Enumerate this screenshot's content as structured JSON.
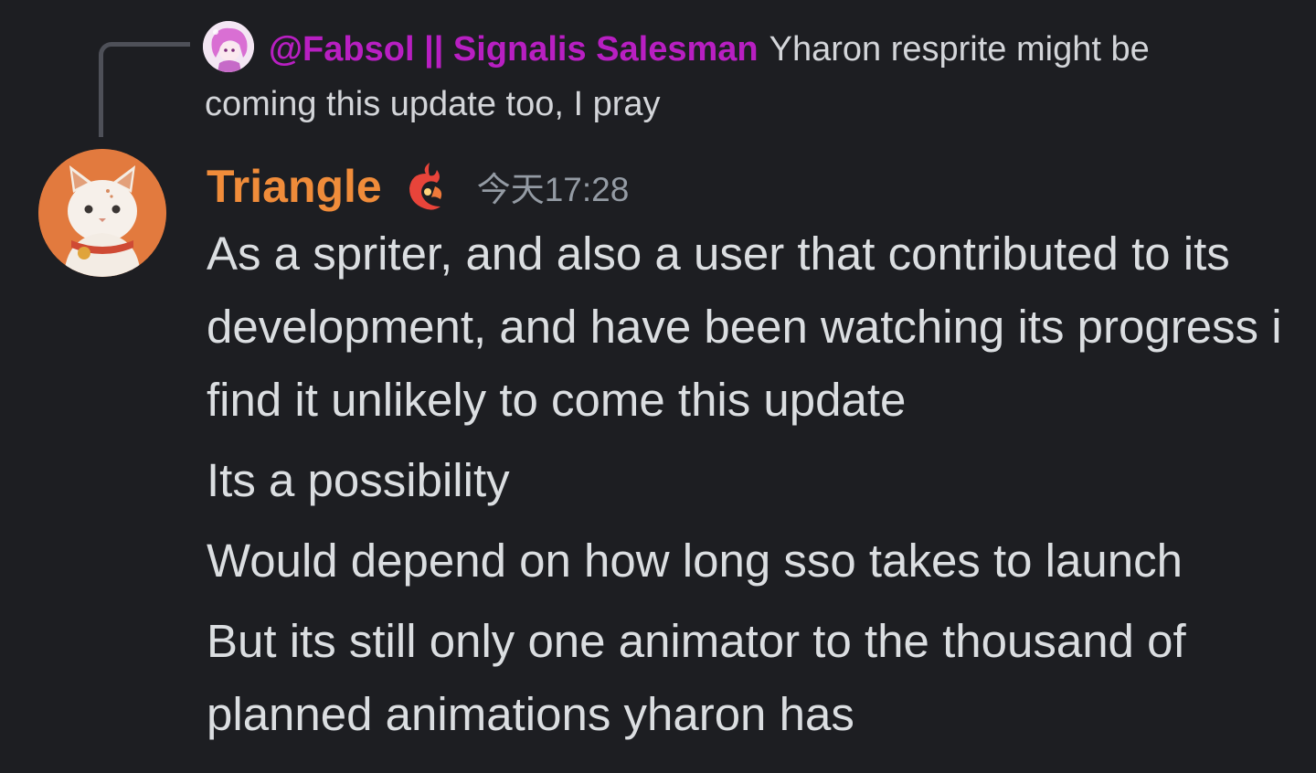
{
  "reply": {
    "author": "@Fabsol || Signalis Salesman",
    "text": "Yharon resprite might be coming this update too, I pray"
  },
  "message": {
    "author": "Triangle",
    "timestamp": "今天17:28",
    "lines": [
      "As a spriter, and also a user that contributed to its development, and have been watching its progress i find it unlikely to come this update",
      "Its a possibility",
      "Would depend on how long sso takes to launch",
      "But its still only one animator to the thousand of planned animations yharon has"
    ]
  },
  "colors": {
    "background": "#1d1e22",
    "reply_author": "#b81fc2",
    "username": "#f08c3a",
    "timestamp": "#949ba4",
    "text": "#dbdee1"
  },
  "icons": {
    "role_icon": "flame-emblem-icon",
    "main_avatar": "cat-avatar",
    "reply_avatar": "anime-avatar"
  }
}
